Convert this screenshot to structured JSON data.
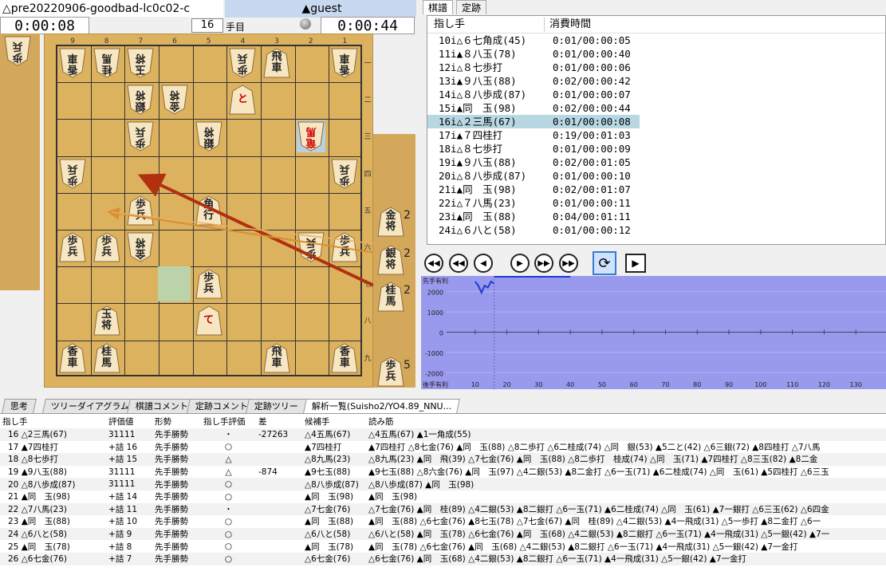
{
  "players": {
    "gote_name": "△pre20220906-goodbad-lc0c02-c",
    "sente_name": "▲guest",
    "gote_time": "0:00:08",
    "sente_time": "0:00:44",
    "move_no": "16",
    "move_suffix": "手目"
  },
  "board": {
    "files": [
      "9",
      "8",
      "7",
      "6",
      "5",
      "4",
      "3",
      "2",
      "1"
    ],
    "ranks": [
      "一",
      "二",
      "三",
      "四",
      "五",
      "六",
      "七",
      "八",
      "九"
    ],
    "pieces": [
      {
        "f": 9,
        "r": 1,
        "t": "香車",
        "o": "g"
      },
      {
        "f": 8,
        "r": 1,
        "t": "桂馬",
        "o": "g"
      },
      {
        "f": 7,
        "r": 1,
        "t": "玉将",
        "o": "g"
      },
      {
        "f": 4,
        "r": 1,
        "t": "歩兵",
        "o": "g"
      },
      {
        "f": 3,
        "r": 1,
        "t": "飛車",
        "o": "s"
      },
      {
        "f": 1,
        "r": 1,
        "t": "香車",
        "o": "g"
      },
      {
        "f": 7,
        "r": 2,
        "t": "銀将",
        "o": "g"
      },
      {
        "f": 6,
        "r": 2,
        "t": "金将",
        "o": "g"
      },
      {
        "f": 4,
        "r": 2,
        "t": "と",
        "o": "s",
        "promoted": true
      },
      {
        "f": 7,
        "r": 3,
        "t": "歩兵",
        "o": "g"
      },
      {
        "f": 5,
        "r": 3,
        "t": "銀将",
        "o": "g"
      },
      {
        "f": 2,
        "r": 3,
        "t": "竜馬",
        "o": "g",
        "promoted": true,
        "last": true
      },
      {
        "f": 9,
        "r": 4,
        "t": "歩兵",
        "o": "g"
      },
      {
        "f": 1,
        "r": 4,
        "t": "歩兵",
        "o": "g"
      },
      {
        "f": 7,
        "r": 5,
        "t": "歩兵",
        "o": "s"
      },
      {
        "f": 5,
        "r": 5,
        "t": "角行",
        "o": "s"
      },
      {
        "f": 9,
        "r": 6,
        "t": "歩兵",
        "o": "s"
      },
      {
        "f": 8,
        "r": 6,
        "t": "歩兵",
        "o": "s"
      },
      {
        "f": 7,
        "r": 6,
        "t": "金将",
        "o": "g"
      },
      {
        "f": 2,
        "r": 6,
        "t": "歩兵",
        "o": "g"
      },
      {
        "f": 1,
        "r": 6,
        "t": "歩兵",
        "o": "s"
      },
      {
        "f": 5,
        "r": 7,
        "t": "歩兵",
        "o": "s"
      },
      {
        "f": 8,
        "r": 8,
        "t": "玉将",
        "o": "s"
      },
      {
        "f": 5,
        "r": 8,
        "t": "て",
        "o": "s",
        "promoted": true
      },
      {
        "f": 9,
        "r": 9,
        "t": "香車",
        "o": "s"
      },
      {
        "f": 8,
        "r": 9,
        "t": "桂馬",
        "o": "s"
      },
      {
        "f": 3,
        "r": 9,
        "t": "飛車",
        "o": "s"
      },
      {
        "f": 1,
        "r": 9,
        "t": "香車",
        "o": "s"
      }
    ],
    "gote_hand": [
      {
        "t": "歩兵"
      }
    ],
    "sente_hand": [
      {
        "t": "金将",
        "n": "2"
      },
      {
        "t": "銀将",
        "n": "2"
      },
      {
        "t": "桂馬",
        "n": "2"
      },
      {
        "t": "歩兵",
        "n": "5"
      }
    ]
  },
  "record": {
    "tabs": [
      "棋譜",
      "定跡"
    ],
    "headers": [
      "指し手",
      "消費時間"
    ],
    "moves": [
      {
        "m": "10i△６七角成(45)",
        "t": "0:01/00:00:05"
      },
      {
        "m": "11i▲８八玉(78)",
        "t": "0:01/00:00:40"
      },
      {
        "m": "12i△８七歩打",
        "t": "0:01/00:00:06"
      },
      {
        "m": "13i▲９八玉(88)",
        "t": "0:02/00:00:42"
      },
      {
        "m": "14i△８八歩成(87)",
        "t": "0:01/00:00:07"
      },
      {
        "m": "15i▲同　玉(98)",
        "t": "0:02/00:00:44"
      },
      {
        "m": "16i△２三馬(67)",
        "t": "0:01/00:00:08",
        "selected": true
      },
      {
        "m": "17i▲７四桂打",
        "t": "0:19/00:01:03"
      },
      {
        "m": "18i△８七歩打",
        "t": "0:01/00:00:09"
      },
      {
        "m": "19i▲９八玉(88)",
        "t": "0:02/00:01:05"
      },
      {
        "m": "20i△８八歩成(87)",
        "t": "0:01/00:00:10"
      },
      {
        "m": "21i▲同　玉(98)",
        "t": "0:02/00:01:07"
      },
      {
        "m": "22i△７八馬(23)",
        "t": "0:01/00:00:11"
      },
      {
        "m": "23i▲同　玉(88)",
        "t": "0:04/00:01:11"
      },
      {
        "m": "24i△６八と(58)",
        "t": "0:01/00:00:12"
      }
    ]
  },
  "graph": {
    "top_label": "先手有利",
    "bottom_label": "後手有利",
    "y_ticks": [
      "2000",
      "1000",
      "0",
      "-1000",
      "-2000"
    ],
    "x_ticks": [
      "10",
      "20",
      "30",
      "40",
      "50",
      "60",
      "70",
      "80",
      "90",
      "100",
      "110",
      "120",
      "130"
    ],
    "evals": [
      2500,
      2300,
      1950,
      2300,
      2200,
      2500,
      2400
    ]
  },
  "bottom_tabs": [
    "思考",
    "ツリーダイアグラム",
    "棋譜コメント",
    "定跡コメント",
    "定跡ツリー",
    "解析一覧(Suisho2/YO4.89_NNU..."
  ],
  "analysis": {
    "headers": [
      "指し手",
      "評価値",
      "形勢",
      "指し手評価",
      "差",
      "候補手",
      "読み筋"
    ],
    "rows": [
      [
        "16 △2三馬(67)",
        "31111",
        "先手勝勢",
        "・",
        "-27263",
        "△4五馬(67)",
        "△4五馬(67) ▲1一角成(55)"
      ],
      [
        "17 ▲7四桂打",
        "+詰 16",
        "先手勝勢",
        "○",
        "",
        "▲7四桂打",
        "▲7四桂打 △8七金(76) ▲同　玉(88) △8二歩打 △6二桂成(74) △同　銀(53) ▲5二と(42) △6三銀(72) ▲8四桂打 △7八馬"
      ],
      [
        "18 △8七歩打",
        "+詰 15",
        "先手勝勢",
        "△",
        "",
        "△8九馬(23)",
        "△8九馬(23) ▲同　飛(39) △7七金(76) ▲同　玉(88) △8二歩打　桂成(74) △同　玉(71) ▲7四桂打 △8三玉(82) ▲8二金"
      ],
      [
        "19 ▲9八玉(88)",
        "31111",
        "先手勝勢",
        "△",
        "-874",
        "▲9七玉(88)",
        "▲9七玉(88) △8六金(76) ▲同　玉(97) △4二銀(53) ▲8二金打 △6一玉(71) ▲6二桂成(74) △同　玉(61) ▲5四桂打 △6三玉"
      ],
      [
        "20 △8八歩成(87)",
        "31111",
        "先手勝勢",
        "○",
        "",
        "△8八歩成(87)",
        "△8八歩成(87) ▲同　玉(98)"
      ],
      [
        "21 ▲同　玉(98)",
        "+詰 14",
        "先手勝勢",
        "○",
        "",
        "▲同　玉(98)",
        "▲同　玉(98)"
      ],
      [
        "22 △7八馬(23)",
        "+詰 11",
        "先手勝勢",
        "・",
        "",
        "△7七金(76)",
        "△7七金(76) ▲同　桂(89) △4二銀(53) ▲8二銀打 △6一玉(71) ▲6二桂成(74) △同　玉(61) ▲7一銀打 △6三玉(62) △6四金"
      ],
      [
        "23 ▲同　玉(88)",
        "+詰 10",
        "先手勝勢",
        "○",
        "",
        "▲同　玉(88)",
        "▲同　玉(88) △6七金(76) ▲8七玉(78) △7七金(67) ▲同　桂(89) △4二銀(53) ▲4一飛成(31) △5一歩打 ▲8二金打 △6一"
      ],
      [
        "24 △6八と(58)",
        "+詰 9",
        "先手勝勢",
        "○",
        "",
        "△6八と(58)",
        "△6八と(58) ▲同　玉(78) △6七金(76) ▲同　玉(68) △4二銀(53) ▲8二銀打 △6一玉(71) ▲4一飛成(31) △5一銀(42) ▲7一"
      ],
      [
        "25 ▲同　玉(78)",
        "+詰 8",
        "先手勝勢",
        "○",
        "",
        "▲同　玉(78)",
        "▲同　玉(78) △6七金(76) ▲同　玉(68) △4二銀(53) ▲8二銀打 △6一玉(71) ▲4一飛成(31) △5一銀(42) ▲7一金打"
      ],
      [
        "26 △6七金(76)",
        "+詰 7",
        "先手勝勢",
        "○",
        "",
        "△6七金(76)",
        "△6七金(76) ▲同　玉(68) △4二銀(53) ▲8二銀打 △6一玉(71) ▲4一飛成(31) △5一銀(42) ▲7一金打"
      ]
    ]
  },
  "colors": {
    "board": "#ddb25e",
    "graph_bg": "#9999ee",
    "selected": "#b7d8e3",
    "arrow_red": "#b03010",
    "arrow_orange": "#d89030"
  }
}
